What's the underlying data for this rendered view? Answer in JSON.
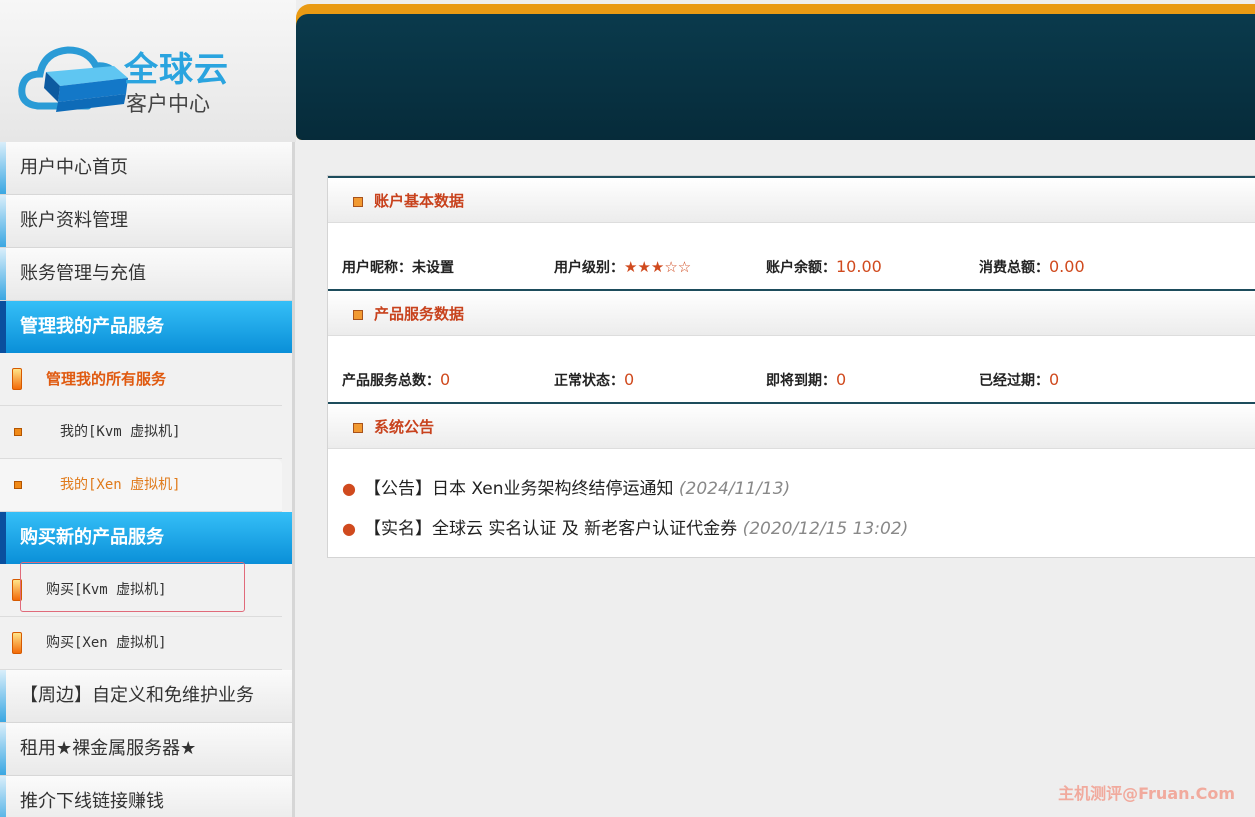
{
  "logo": {
    "main": "全球云",
    "sub": "客户中心"
  },
  "sidebar": {
    "items": [
      {
        "label": "用户中心首页"
      },
      {
        "label": "账户资料管理"
      },
      {
        "label": "账务管理与充值"
      }
    ],
    "section_manage": "管理我的产品服务",
    "manage_items": [
      {
        "label": "管理我的所有服务"
      },
      {
        "label": "我的[Kvm 虚拟机]"
      },
      {
        "label": "我的[Xen 虚拟机]"
      }
    ],
    "section_buy": "购买新的产品服务",
    "buy_items": [
      {
        "label": "购买[Kvm 虚拟机]"
      },
      {
        "label": "购买[Xen 虚拟机]"
      }
    ],
    "bottom_items": [
      {
        "label": "【周边】自定义和免维护业务"
      },
      {
        "label": "租用★裸金属服务器★"
      },
      {
        "label": "推介下线链接赚钱"
      }
    ]
  },
  "account": {
    "title": "账户基本数据",
    "nickname_label": "用户昵称：",
    "nickname_value": "未设置",
    "level_label": "用户级别：",
    "level_value": "★★★☆☆",
    "balance_label": "账户余额：",
    "balance_value": "10.00",
    "spent_label": "消费总额：",
    "spent_value": "0.00"
  },
  "products": {
    "title": "产品服务数据",
    "total_label": "产品服务总数：",
    "total_value": "0",
    "normal_label": "正常状态：",
    "normal_value": "0",
    "expiring_label": "即将到期：",
    "expiring_value": "0",
    "expired_label": "已经过期：",
    "expired_value": "0"
  },
  "notices": {
    "title": "系统公告",
    "items": [
      {
        "text": "【公告】日本 Xen业务架构终结停运通知",
        "date": "(2024/11/13)"
      },
      {
        "text": "【实名】全球云 实名认证 及 新老客户认证代金券",
        "date": "(2020/12/15 13:02)"
      }
    ]
  },
  "watermark": "主机测评@Fruan.Com",
  "colors": {
    "accent_orange": "#e99a13",
    "header_dark": "#062b3a",
    "section_blue": "#0a8fd8",
    "value_red": "#d04a1e"
  }
}
